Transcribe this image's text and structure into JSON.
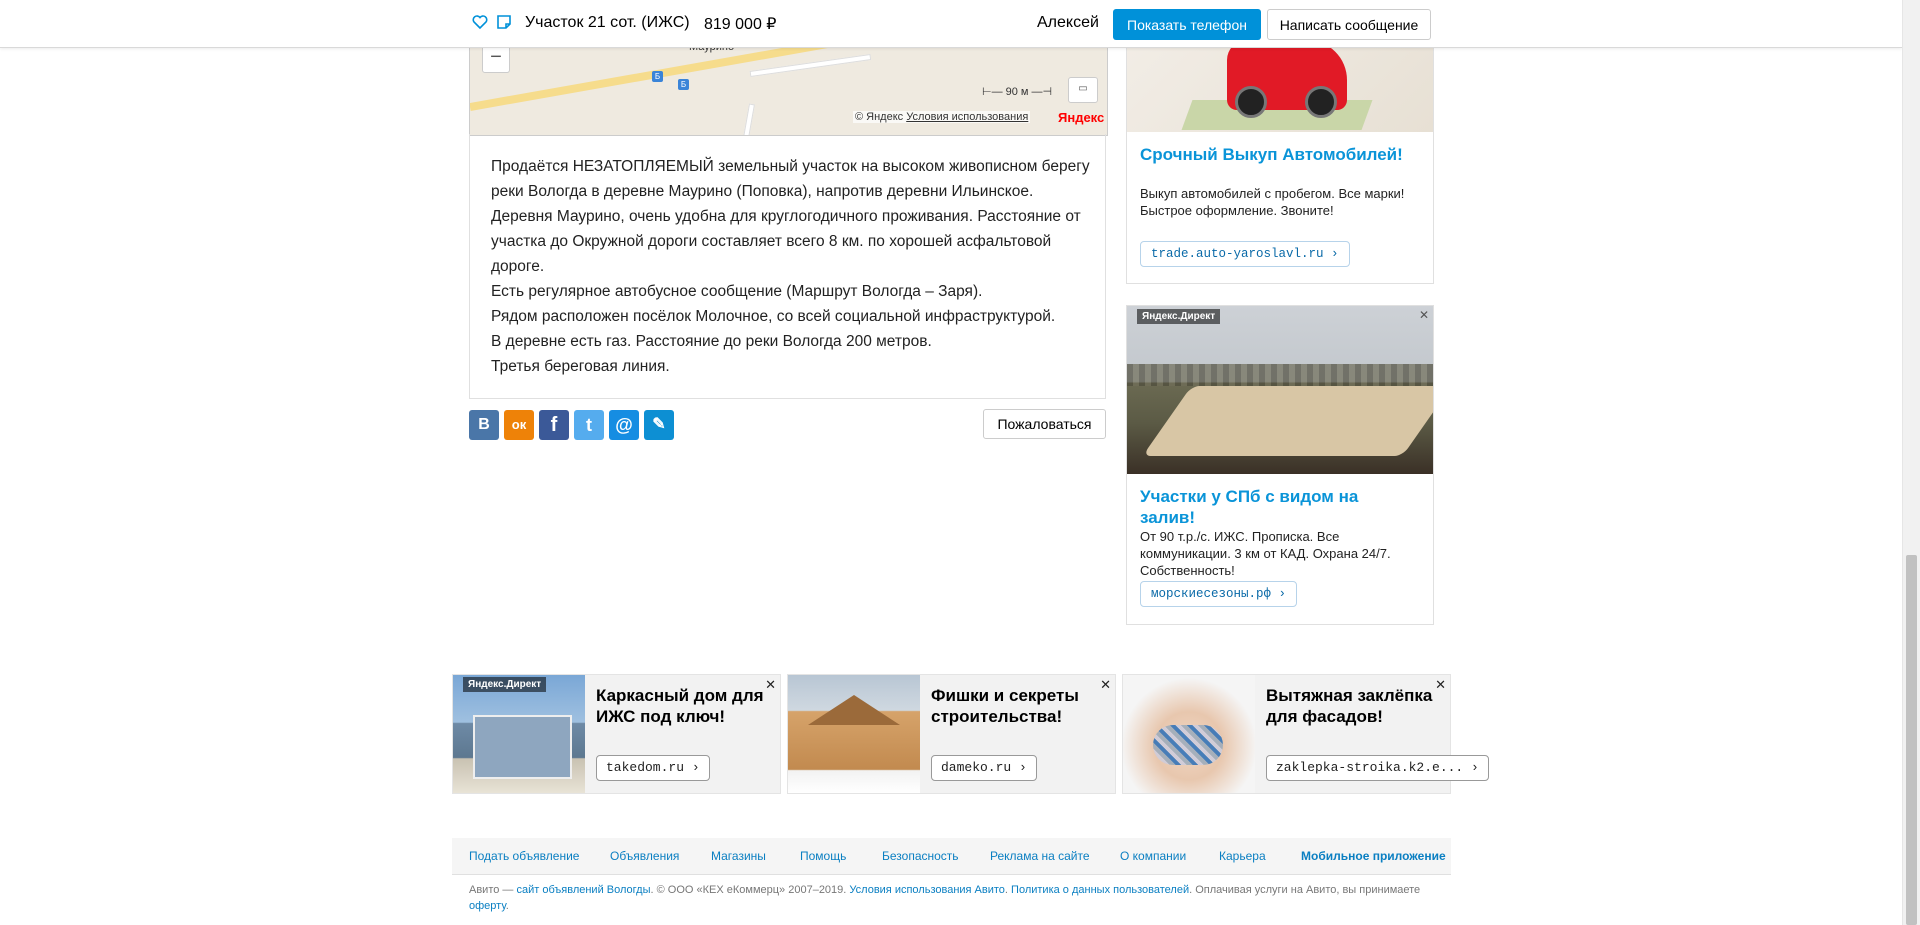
{
  "header": {
    "favorite_icon": "heart-outline-icon",
    "note_icon": "note-icon",
    "title": "Участок 21 сот. (ИЖС)",
    "price": "819 000 ₽",
    "seller": "Алексей",
    "show_phone": "Показать телефон",
    "write_message": "Написать сообщение"
  },
  "map": {
    "village_label": "Маурино",
    "zoom_out": "−",
    "scale": "90 м",
    "copyright": "© Яндекс",
    "terms": "Условия использования",
    "logo": "Яндекс",
    "bus_glyph": "Б"
  },
  "description": {
    "lines": [
      "Продаётся НЕЗАТОПЛЯЕМЫЙ земельный участок на высоком живописном берегу реки Вологда в деревне Маурино (Поповка), напротив деревни Ильинское. Деревня Маурино, очень удобна для круглогодичного проживания. Расстояние от участка до Окружной дороги составляет всего 8 км. по хорошей асфальтовой дороге.",
      "Есть регулярное автобусное сообщение (Маршрут Вологда – Заря).",
      "Рядом расположен посёлок Молочное, со всей социальной инфраструктурой.",
      "В деревне есть газ. Расстояние до реки Вологда 200 метров.",
      "Третья береговая линия."
    ]
  },
  "share": {
    "vk": "В",
    "ok": "ок",
    "fb": "f",
    "tw": "t",
    "mail": "@",
    "lj": "✎",
    "colors": {
      "vk": "#4a76a8",
      "ok": "#ee8208",
      "fb": "#3b5998",
      "tw": "#55acee",
      "mail": "#168de2",
      "lj": "#0d8fd3"
    },
    "complain": "Пожаловаться"
  },
  "right_ads": [
    {
      "title": "Срочный Выкуп Автомобилей!",
      "text": "Выкуп автомобилей с пробегом. Все марки! Быстрое оформление. Звоните!",
      "link": "trade.auto-yaroslavl.ru ›"
    },
    {
      "badge": "Яндекс.Директ",
      "close": "✕",
      "title": "Участки у СПб с видом на залив!",
      "text": "От 90 т.р./с. ИЖС. Прописка. Все коммуникации. 3 км от КАД. Охрана 24/7. Собственность!",
      "link": "морскиесезоны.рф ›"
    }
  ],
  "bottom_ads": [
    {
      "badge": "Яндекс.Директ",
      "title": "Каркасный дом для ИЖС под ключ!",
      "link": "takedom.ru ›",
      "close": "✕"
    },
    {
      "title": "Фишки и секреты строительства!",
      "link": "dameko.ru ›",
      "close": "✕"
    },
    {
      "title": "Вытяжная заклёпка для фасадов!",
      "link": "zaklepka-stroika.k2.e... ›",
      "close": "✕"
    }
  ],
  "footer": {
    "nav": [
      "Подать объявление",
      "Объявления",
      "Магазины",
      "Помощь",
      "Безопасность",
      "Реклама на сайте",
      "О компании",
      "Карьера",
      "Мобильное приложение"
    ],
    "copy_prefix": "Авито — ",
    "copy_link1": "сайт объявлений Вологды",
    "copy_mid": ". © ООО «КЕХ еКоммерц» 2007–2019. ",
    "copy_link2": "Условия использования Авито",
    "copy_dot": ". ",
    "copy_link3": "Политика о данных пользователей",
    "copy_tail": ". Оплачивая услуги на Авито, вы принимаете ",
    "copy_link4": "оферту",
    "copy_end": "."
  }
}
